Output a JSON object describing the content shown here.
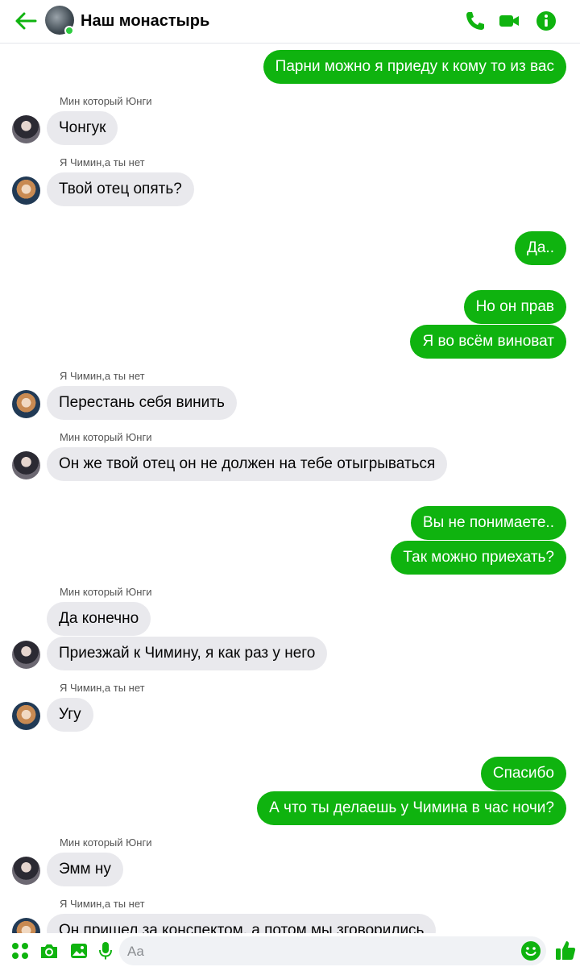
{
  "header": {
    "title": "Наш монастырь"
  },
  "colors": {
    "accent": "#0fb30f",
    "incoming_bubble": "#e9e9ed",
    "online": "#2ecc40"
  },
  "icons": {
    "back": "arrow-left-icon",
    "call": "phone-icon",
    "video": "video-camera-icon",
    "info": "info-icon",
    "menu": "grid-dots-icon",
    "camera": "camera-icon",
    "gallery": "image-icon",
    "mic": "microphone-icon",
    "emoji": "smiley-icon",
    "like": "thumbs-up-icon"
  },
  "messages": {
    "m1": "Парни можно я приеду к кому то из вас",
    "s1": "Мин который Юнги",
    "m2": "Чонгук",
    "s2": "Я Чимин,а ты нет",
    "m3": "Твой отец опять?",
    "m4": "Да..",
    "m5": "Но он прав",
    "m6": "Я во всём виноват",
    "s3": "Я Чимин,а ты нет",
    "m7": "Перестань себя винить",
    "s4": "Мин который Юнги",
    "m8": "Он же твой отец он не должен на тебе отыгрываться",
    "m9": "Вы не понимаете..",
    "m10": "Так можно приехать?",
    "s5": "Мин который Юнги",
    "m11": "Да конечно",
    "m12": "Приезжай к Чимину, я как раз у него",
    "s6": "Я Чимин,а ты нет",
    "m13": "Угу",
    "m14": "Спасибо",
    "m15": "А что ты делаешь у Чимина в час ночи?",
    "s7": "Мин который Юнги",
    "m16": "Эмм ну",
    "s8": "Я Чимин,а ты нет",
    "m17": "Он пришел за конспектом, а потом мы зговорились"
  },
  "composer": {
    "placeholder": "Aa"
  }
}
